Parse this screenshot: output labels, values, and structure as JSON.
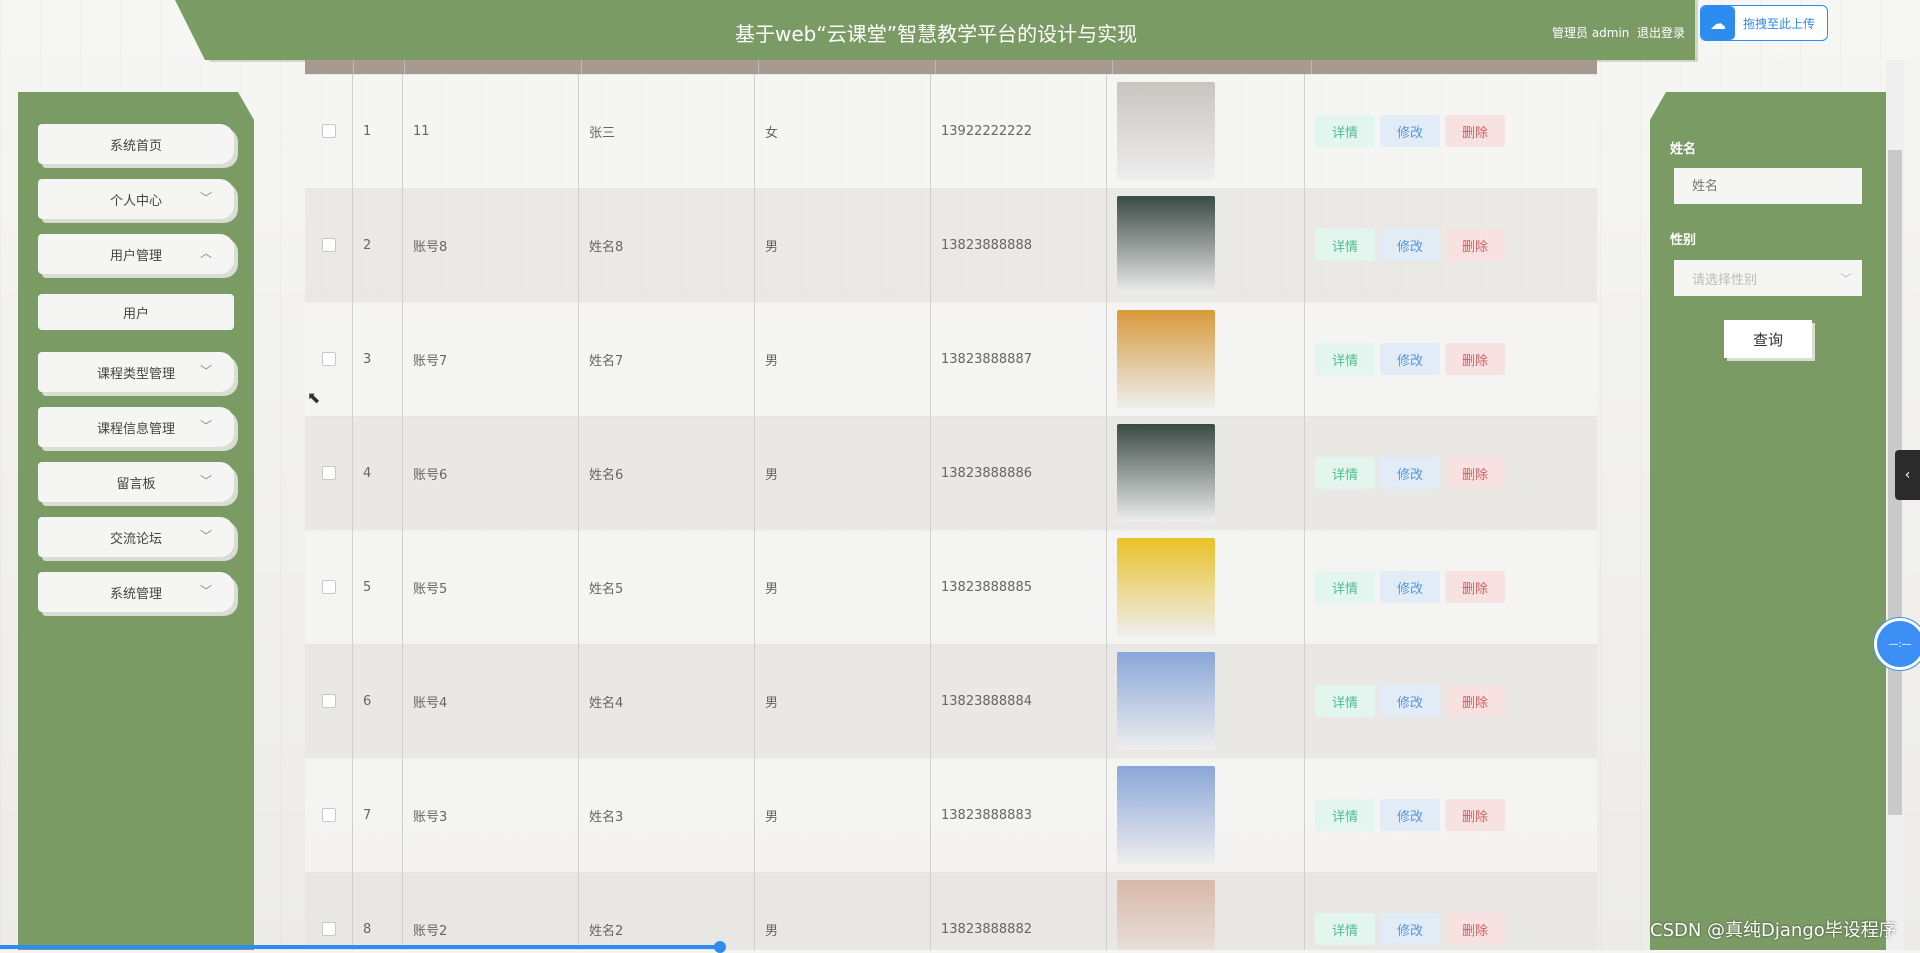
{
  "header": {
    "title": "基于web“云课堂”智慧教学平台的设计与实现",
    "admin_label": "管理员 admin",
    "logout_label": "退出登录",
    "upload_label": "拖拽至此上传"
  },
  "sidebar": {
    "items": [
      {
        "label": "系统首页",
        "chevron": ""
      },
      {
        "label": "个人中心",
        "chevron": "﹀"
      },
      {
        "label": "用户管理",
        "chevron": "︿"
      },
      {
        "label": "用户",
        "chevron": ""
      },
      {
        "label": "课程类型管理",
        "chevron": "﹀"
      },
      {
        "label": "课程信息管理",
        "chevron": "﹀"
      },
      {
        "label": "留言板",
        "chevron": "﹀"
      },
      {
        "label": "交流论坛",
        "chevron": "﹀"
      },
      {
        "label": "系统管理",
        "chevron": "﹀"
      }
    ]
  },
  "table": {
    "actions": {
      "detail": "详情",
      "edit": "修改",
      "delete": "删除"
    },
    "rows": [
      {
        "idx": "1",
        "account": "11",
        "name": "张三",
        "gender": "女",
        "phone": "13922222222",
        "avatar_color": "#c9c4c0"
      },
      {
        "idx": "2",
        "account": "账号8",
        "name": "姓名8",
        "gender": "男",
        "phone": "13823888888",
        "avatar_color": "#3a4a44"
      },
      {
        "idx": "3",
        "account": "账号7",
        "name": "姓名7",
        "gender": "男",
        "phone": "13823888887",
        "avatar_color": "#d79a3a"
      },
      {
        "idx": "4",
        "account": "账号6",
        "name": "姓名6",
        "gender": "男",
        "phone": "13823888886",
        "avatar_color": "#3a4a44"
      },
      {
        "idx": "5",
        "account": "账号5",
        "name": "姓名5",
        "gender": "男",
        "phone": "13823888885",
        "avatar_color": "#e8c227"
      },
      {
        "idx": "6",
        "account": "账号4",
        "name": "姓名4",
        "gender": "男",
        "phone": "13823888884",
        "avatar_color": "#8aa6d8"
      },
      {
        "idx": "7",
        "account": "账号3",
        "name": "姓名3",
        "gender": "男",
        "phone": "13823888883",
        "avatar_color": "#8aa6d8"
      },
      {
        "idx": "8",
        "account": "账号2",
        "name": "姓名2",
        "gender": "男",
        "phone": "13823888882",
        "avatar_color": "#d8b8a8"
      }
    ]
  },
  "search": {
    "name_label": "姓名",
    "name_placeholder": "姓名",
    "gender_label": "性别",
    "gender_placeholder": "请选择性别",
    "query_label": "查询"
  },
  "watermark": "CSDN @真纯Django毕设程序",
  "float_ball": "—:—"
}
